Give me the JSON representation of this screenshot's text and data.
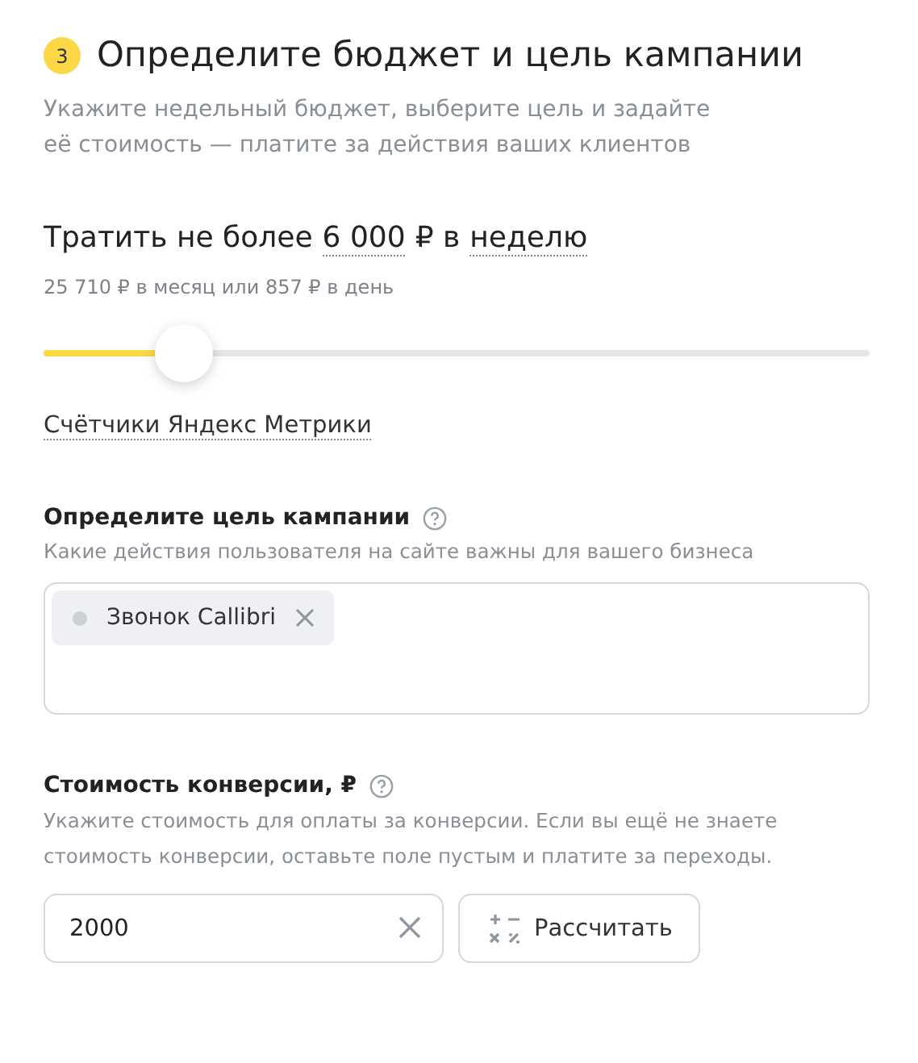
{
  "step": {
    "number": "3",
    "title": "Определите бюджет и цель кампании",
    "description": "Укажите недельный бюджет, выберите цель и задайте её стоимость — платите за действия ваших клиентов"
  },
  "budget": {
    "prefix": "Тратить не более",
    "amount": "6 000",
    "middle": "₽ в",
    "period": "неделю",
    "summary": "25 710 ₽ в месяц или 857 ₽ в день",
    "level": 0.17
  },
  "metrika_link": "Счётчики Яндекс Метрики",
  "goal": {
    "label": "Определите цель кампании",
    "hint": "Какие действия пользователя на сайте важны для вашего бизнеса",
    "tags": [
      {
        "label": "Звонок Callibri",
        "color": "#c9d0d8"
      }
    ]
  },
  "conversion": {
    "label": "Стоимость конверсии, ₽",
    "hint": "Укажите стоимость для оплаты за конверсии. Если вы ещё не знаете стоимость конверсии, оставьте поле пустым и платите за переходы.",
    "value": "2000",
    "button": "Рассчитать"
  }
}
